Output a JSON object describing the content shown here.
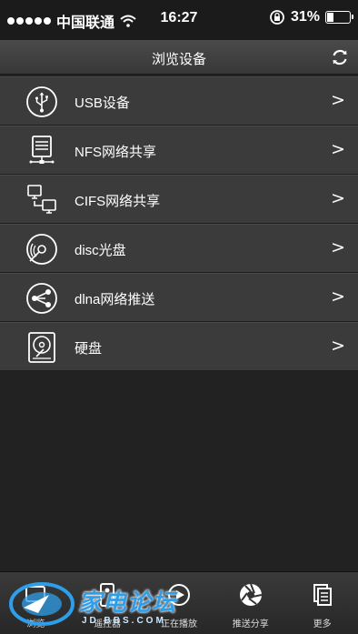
{
  "status_bar": {
    "carrier": "中国联通",
    "time": "16:27",
    "battery": "31%",
    "battery_level": 0.31
  },
  "nav": {
    "title": "浏览设备",
    "refresh_icon": "refresh-icon"
  },
  "devices": [
    {
      "label": "USB设备",
      "icon": "usb-icon",
      "chevron": ">"
    },
    {
      "label": "NFS网络共享",
      "icon": "server-icon",
      "chevron": ">"
    },
    {
      "label": "CIFS网络共享",
      "icon": "network-computers-icon",
      "chevron": ">"
    },
    {
      "label": "disc光盘",
      "icon": "disc-icon",
      "chevron": ">"
    },
    {
      "label": "dlna网络推送",
      "icon": "share-icon",
      "chevron": ">"
    },
    {
      "label": "硬盘",
      "icon": "harddisk-icon",
      "chevron": ">"
    }
  ],
  "tabs": [
    {
      "label": "浏览",
      "icon": "browse-icon"
    },
    {
      "label": "遥控器",
      "icon": "remote-icon"
    },
    {
      "label": "正在播放",
      "icon": "now-playing-icon"
    },
    {
      "label": "推送分享",
      "icon": "aperture-icon"
    },
    {
      "label": "更多",
      "icon": "more-icon"
    }
  ],
  "watermark": {
    "text": "家电论坛",
    "sub": "JD BBS.COM"
  },
  "colors": {
    "background": "#222222",
    "row": "#3b3b3b",
    "nav": "#404040",
    "watermark_blue": "#2f9ee8"
  }
}
